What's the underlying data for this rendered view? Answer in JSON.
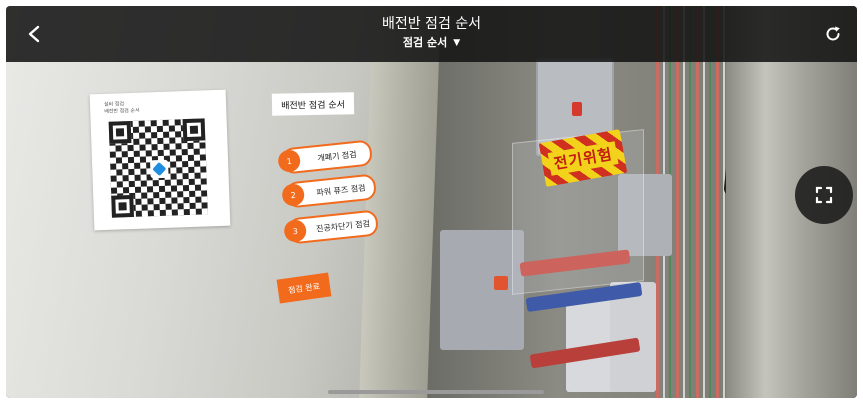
{
  "header": {
    "title": "배전반 점검 순서",
    "subtitle": "점검 순서",
    "back_icon": "chevron-left-icon",
    "refresh_icon": "refresh-icon",
    "dropdown_icon": "caret-down-icon"
  },
  "ar_overlay": {
    "title_label": "배전반 점검 순서",
    "steps": [
      {
        "number": "1",
        "label": "개폐기 점검"
      },
      {
        "number": "2",
        "label": "파워 퓨즈 점검"
      },
      {
        "number": "3",
        "label": "진공차단기 점검"
      }
    ],
    "complete_label": "점검 완료"
  },
  "scene": {
    "danger_sign": "전기위험",
    "qr_card_title": "설비 점검\n배전반 점검 순서"
  },
  "controls": {
    "fullscreen_icon": "fullscreen-icon"
  },
  "colors": {
    "accent": "#f26b1d",
    "topbar": "#141414",
    "danger_yellow": "#f2d21a",
    "danger_red": "#c21d10"
  }
}
